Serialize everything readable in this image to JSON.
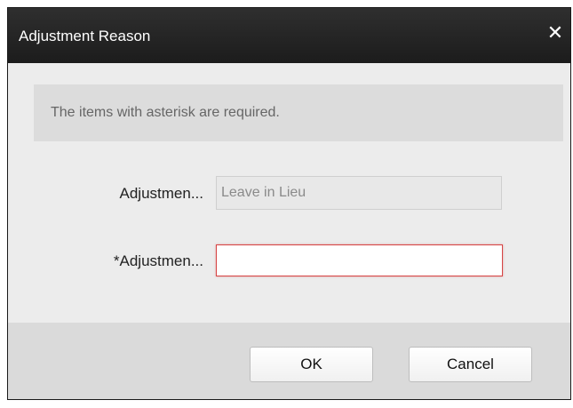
{
  "dialog": {
    "title": "Adjustment Reason",
    "close_symbol": "✕",
    "close_icon": "close-icon"
  },
  "notice": {
    "text": "The items with asterisk are required."
  },
  "fields": [
    {
      "label": "Adjustmen...",
      "value": "Leave in Lieu",
      "required": false,
      "readonly": true
    },
    {
      "label": "*Adjustmen...",
      "value": "",
      "required": true,
      "readonly": false
    }
  ],
  "buttons": {
    "ok_label": "OK",
    "cancel_label": "Cancel"
  },
  "colors": {
    "titlebar": "#1c1c1c",
    "background": "#ececec",
    "error_border": "#d64545"
  }
}
